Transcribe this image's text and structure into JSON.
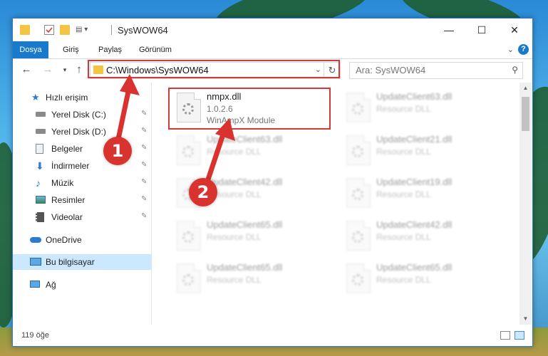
{
  "window": {
    "title": "SysWOW64"
  },
  "ribbon": {
    "tabs": [
      {
        "label": "Dosya",
        "active": true
      },
      {
        "label": "Giriş",
        "active": false
      },
      {
        "label": "Paylaş",
        "active": false
      },
      {
        "label": "Görünüm",
        "active": false
      }
    ],
    "help": "?"
  },
  "address": {
    "path": "C:\\Windows\\SysWOW64",
    "search_placeholder": "Ara: SysWOW64"
  },
  "nav_pane": {
    "items": [
      {
        "label": "Hızlı erişim",
        "icon": "star-icon",
        "pinned": false
      },
      {
        "label": "Yerel Disk (C:)",
        "icon": "drive-icon",
        "pinned": true
      },
      {
        "label": "Yerel Disk (D:)",
        "icon": "drive-icon",
        "pinned": true
      },
      {
        "label": "Belgeler",
        "icon": "documents-icon",
        "pinned": true
      },
      {
        "label": "İndirmeler",
        "icon": "downloads-icon",
        "pinned": true
      },
      {
        "label": "Müzik",
        "icon": "music-icon",
        "pinned": true
      },
      {
        "label": "Resimler",
        "icon": "pictures-icon",
        "pinned": true
      },
      {
        "label": "Videolar",
        "icon": "videos-icon",
        "pinned": true
      },
      {
        "label": "OneDrive",
        "icon": "onedrive-icon",
        "pinned": false
      },
      {
        "label": "Bu bilgisayar",
        "icon": "computer-icon",
        "pinned": false,
        "selected": true
      },
      {
        "label": "Ağ",
        "icon": "network-icon",
        "pinned": false
      }
    ]
  },
  "files": {
    "highlighted": {
      "name": "nmpx.dll",
      "version": "1.0.2.6",
      "description": "WinAmpX Module"
    },
    "left_column": [
      {
        "name": "UpdateClient63.dll",
        "type": "Resource DLL"
      },
      {
        "name": "UpdateClient42.dll",
        "type": "Resource DLL"
      },
      {
        "name": "UpdateClient65.dll",
        "type": "Resource DLL"
      },
      {
        "name": "UpdateClient65.dll",
        "type": "Resource DLL"
      }
    ],
    "right_column": [
      {
        "name": "UpdateClient63.dll",
        "type": "Resource DLL"
      },
      {
        "name": "UpdateClient21.dll",
        "type": "Resource DLL"
      },
      {
        "name": "UpdateClient19.dll",
        "type": "Resource DLL"
      },
      {
        "name": "UpdateClient42.dll",
        "type": "Resource DLL"
      },
      {
        "name": "UpdateClient65.dll",
        "type": "Resource DLL"
      }
    ]
  },
  "status": {
    "count": "119 öğe"
  },
  "annotations": {
    "step1": "1",
    "step2": "2",
    "color": "#d8332f"
  }
}
